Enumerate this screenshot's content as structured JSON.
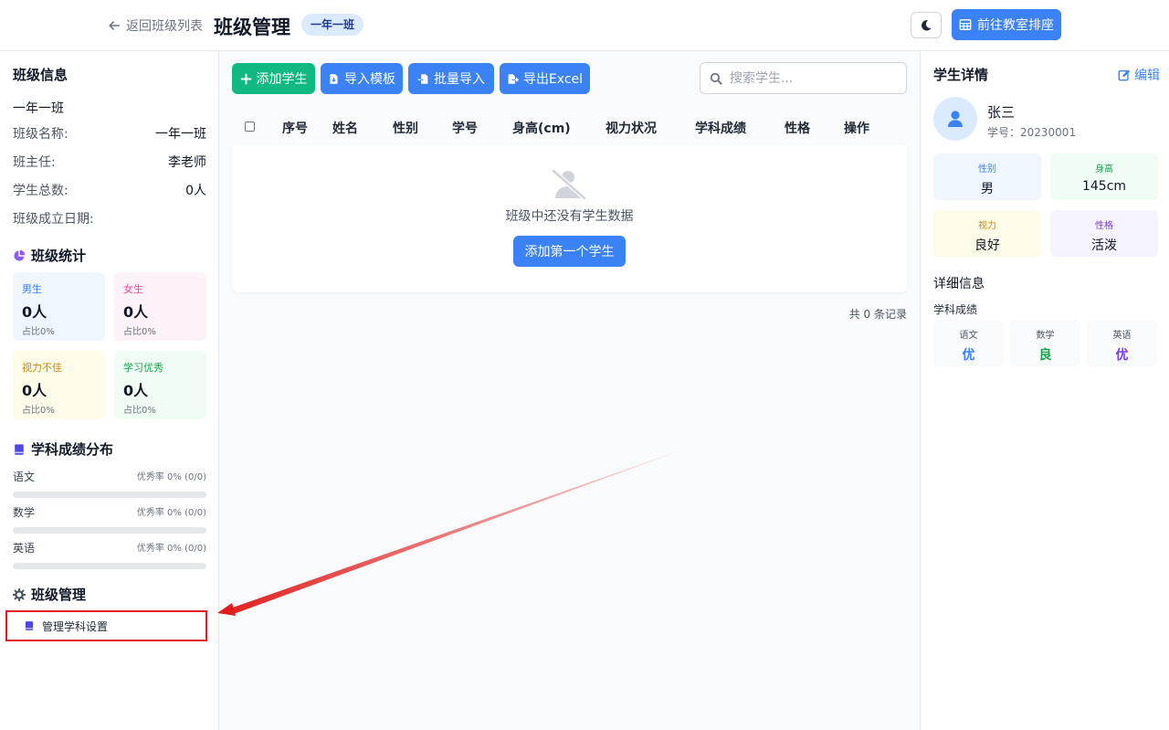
{
  "header": {
    "back_label": "返回班级列表",
    "title": "班级管理",
    "class_badge": "一年一班",
    "seat_button": "前往教室排座"
  },
  "class_info": {
    "title": "班级信息",
    "class_line": "一年一班",
    "rows": [
      {
        "label": "班级名称:",
        "value": "一年一班"
      },
      {
        "label": "班主任:",
        "value": "李老师"
      },
      {
        "label": "学生总数:",
        "value": "0人"
      },
      {
        "label": "班级成立日期:",
        "value": ""
      }
    ]
  },
  "class_stats": {
    "title": "班级统计",
    "cards": [
      {
        "label": "男生",
        "count": "0人",
        "pct": "占比0%",
        "label_color": "#3b82f6",
        "bg": "#eff6ff"
      },
      {
        "label": "女生",
        "count": "0人",
        "pct": "占比0%",
        "label_color": "#ec4899",
        "bg": "#fdf2f8"
      },
      {
        "label": "视力不佳",
        "count": "0人",
        "pct": "占比0%",
        "label_color": "#ca8a04",
        "bg": "#fefce8"
      },
      {
        "label": "学习优秀",
        "count": "0人",
        "pct": "占比0%",
        "label_color": "#16a34a",
        "bg": "#f0fdf4"
      }
    ]
  },
  "subject_dist": {
    "title": "学科成绩分布",
    "subjects": [
      {
        "name": "语文",
        "rate": "优秀率 0% (0/0)",
        "progress": 0
      },
      {
        "name": "数学",
        "rate": "优秀率 0% (0/0)",
        "progress": 0
      },
      {
        "name": "英语",
        "rate": "优秀率 0% (0/0)",
        "progress": 0
      }
    ]
  },
  "class_manage": {
    "title": "班级管理",
    "item": "管理学科设置"
  },
  "toolbar": {
    "add_student": "添加学生",
    "import_template": "导入模板",
    "batch_import": "批量导入",
    "export_excel": "导出Excel",
    "search_placeholder": "搜索学生...",
    "colors": {
      "add": "#10b981",
      "primary": "#3b82f6"
    }
  },
  "table": {
    "columns": [
      "序号",
      "姓名",
      "性别",
      "学号",
      "身高(cm)",
      "视力状况",
      "学科成绩",
      "性格",
      "操作"
    ],
    "empty_text": "班级中还没有学生数据",
    "add_first": "添加第一个学生",
    "total": "共 0 条记录"
  },
  "student_detail": {
    "title": "学生详情",
    "edit": "编辑",
    "name": "张三",
    "id_line": "学号：20230001",
    "cards": [
      {
        "label": "性别",
        "value": "男",
        "label_color": "#3b82f6",
        "bg": "#eff6ff"
      },
      {
        "label": "身高",
        "value": "145cm",
        "label_color": "#16a34a",
        "bg": "#f0fdf4"
      },
      {
        "label": "视力",
        "value": "良好",
        "label_color": "#ca8a04",
        "bg": "#fefce8"
      },
      {
        "label": "性格",
        "value": "活泼",
        "label_color": "#7c3aed",
        "bg": "#f5f3ff"
      }
    ],
    "detail_title": "详细信息",
    "scores_title": "学科成绩",
    "scores": [
      {
        "subject": "语文",
        "grade": "优",
        "color": "#3b82f6"
      },
      {
        "subject": "数学",
        "grade": "良",
        "color": "#16a34a"
      },
      {
        "subject": "英语",
        "grade": "优",
        "color": "#7c3aed"
      }
    ]
  }
}
